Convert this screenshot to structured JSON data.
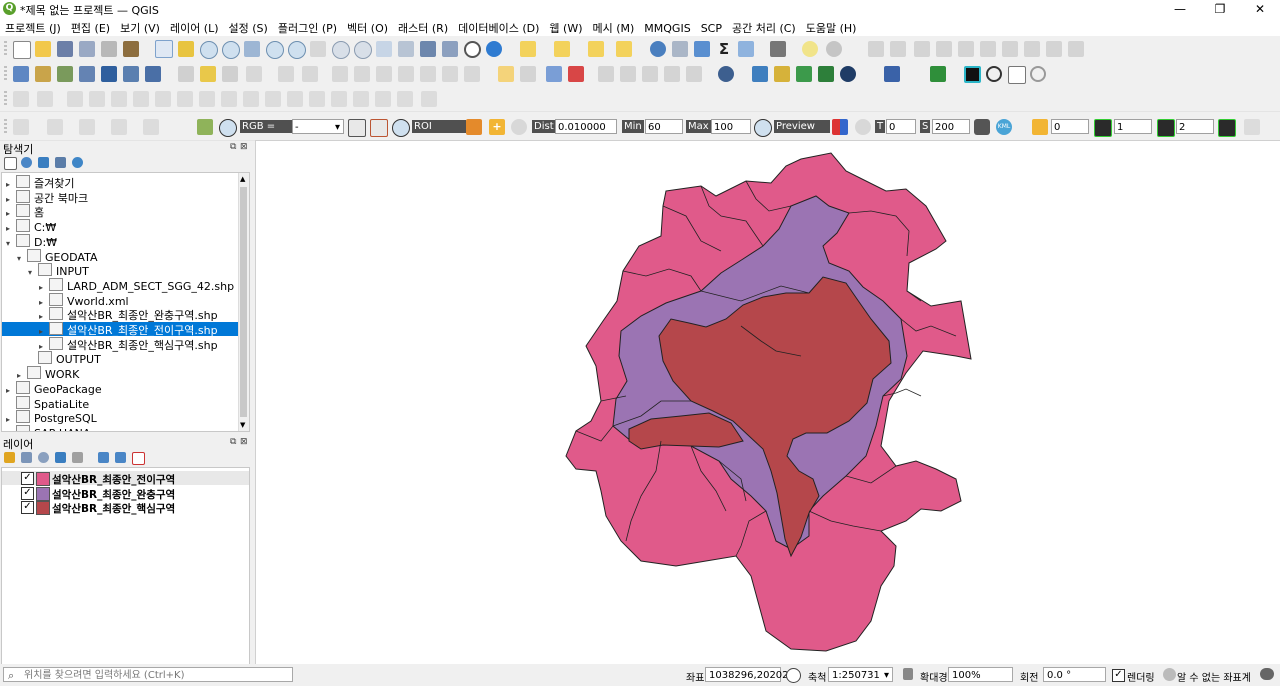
{
  "window": {
    "title": "*제목 없는 프로젝트 — QGIS",
    "min": "—",
    "max": "❐",
    "close": "✕"
  },
  "menu": [
    "프로젝트 (J)",
    "편집 (E)",
    "보기 (V)",
    "레이어 (L)",
    "설정 (S)",
    "플러그인 (P)",
    "벡터 (O)",
    "래스터 (R)",
    "데이터베이스 (D)",
    "웹 (W)",
    "메시 (M)",
    "MMQGIS",
    "SCP",
    "공간 처리 (C)",
    "도움말 (H)"
  ],
  "scp": {
    "rgb_label": "RGB =",
    "rgb_value": "-",
    "roi_label": "ROI",
    "dist_label": "Dist",
    "dist_value": "0.010000",
    "min_label": "Min",
    "min_value": "60",
    "max_label": "Max",
    "max_value": "100",
    "preview_label": "Preview",
    "t_label": "T",
    "t_value": "0",
    "s_label": "S",
    "s_value": "200",
    "kml_label": "KML",
    "n1": "0",
    "n2": "1",
    "n3": "2"
  },
  "browser": {
    "title": "탐색기",
    "items": [
      {
        "label": "즐겨찾기",
        "indent": 0
      },
      {
        "label": "공간 북마크",
        "indent": 0
      },
      {
        "label": "홈",
        "indent": 0
      },
      {
        "label": "C:₩",
        "indent": 0
      },
      {
        "label": "D:₩",
        "indent": 0
      },
      {
        "label": "GEODATA",
        "indent": 1
      },
      {
        "label": "INPUT",
        "indent": 2
      },
      {
        "label": "LARD_ADM_SECT_SGG_42.shp",
        "indent": 3
      },
      {
        "label": "Vworld.xml",
        "indent": 3
      },
      {
        "label": "설악산BR_최종안_완충구역.shp",
        "indent": 3
      },
      {
        "label": "설악산BR_최종안_전이구역.shp",
        "indent": 3,
        "selected": true
      },
      {
        "label": "설악산BR_최종안_핵심구역.shp",
        "indent": 3
      },
      {
        "label": "OUTPUT",
        "indent": 2
      },
      {
        "label": "WORK",
        "indent": 1
      },
      {
        "label": "GeoPackage",
        "indent": 0
      },
      {
        "label": "SpatiaLite",
        "indent": 0
      },
      {
        "label": "PostgreSQL",
        "indent": 0
      },
      {
        "label": "SAP HANA",
        "indent": 0
      }
    ]
  },
  "layers": {
    "title": "레이어",
    "items": [
      {
        "name": "설악산BR_최종안_전이구역",
        "color": "#e05a8a",
        "checked": true
      },
      {
        "name": "설악산BR_최종안_완충구역",
        "color": "#9b74b3",
        "checked": true
      },
      {
        "name": "설악산BR_최종안_핵심구역",
        "color": "#b5474b",
        "checked": true
      }
    ]
  },
  "map": {
    "transition_color": "#e05a8a",
    "buffer_color": "#9b74b3",
    "core_color": "#b5474b"
  },
  "status": {
    "search_placeholder": "위치를 찾으려면 입력하세요 (Ctrl+K)",
    "coord_label": "좌표",
    "coord_value": "1038296,2020234",
    "scale_label": "축척",
    "scale_value": "1:250731",
    "magnifier_label": "확대경",
    "magnifier_value": "100%",
    "rotation_label": "회전",
    "rotation_value": "0.0 °",
    "render_label": "렌더링",
    "crs_label": "알 수 없는 좌표계"
  }
}
